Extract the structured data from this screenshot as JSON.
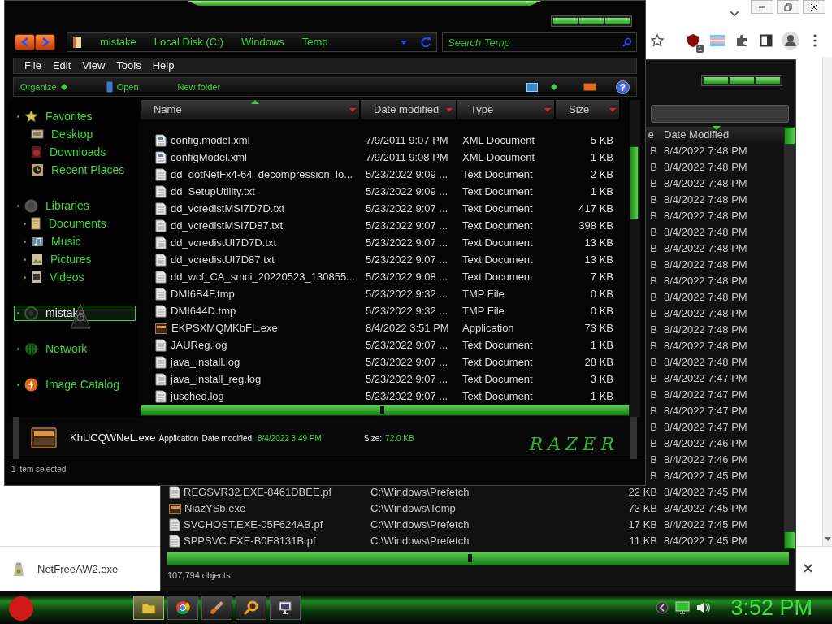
{
  "browser": {
    "extension_badge": "1"
  },
  "download_bar": {
    "file": "NetFreeAW2.exe",
    "close": "✕"
  },
  "back_window": {
    "columns": [
      {
        "label": "e"
      },
      {
        "label": "Date Modified",
        "sorted": true
      }
    ],
    "rows": [
      {
        "size": "B",
        "date": "8/4/2022 7:48 PM"
      },
      {
        "size": "B",
        "date": "8/4/2022 7:48 PM"
      },
      {
        "size": "B",
        "date": "8/4/2022 7:48 PM"
      },
      {
        "size": "B",
        "date": "8/4/2022 7:48 PM"
      },
      {
        "size": "B",
        "date": "8/4/2022 7:48 PM"
      },
      {
        "size": "B",
        "date": "8/4/2022 7:48 PM"
      },
      {
        "size": "B",
        "date": "8/4/2022 7:48 PM"
      },
      {
        "size": "B",
        "date": "8/4/2022 7:48 PM"
      },
      {
        "size": "B",
        "date": "8/4/2022 7:48 PM"
      },
      {
        "size": "B",
        "date": "8/4/2022 7:48 PM"
      },
      {
        "size": "B",
        "date": "8/4/2022 7:48 PM"
      },
      {
        "size": "B",
        "date": "8/4/2022 7:48 PM"
      },
      {
        "size": "B",
        "date": "8/4/2022 7:48 PM"
      },
      {
        "size": "B",
        "date": "8/4/2022 7:48 PM"
      },
      {
        "size": "B",
        "date": "8/4/2022 7:47 PM"
      },
      {
        "size": "B",
        "date": "8/4/2022 7:47 PM"
      },
      {
        "size": "B",
        "date": "8/4/2022 7:47 PM"
      },
      {
        "size": "B",
        "date": "8/4/2022 7:47 PM"
      },
      {
        "size": "B",
        "date": "8/4/2022 7:46 PM"
      },
      {
        "size": "B",
        "date": "8/4/2022 7:46 PM"
      },
      {
        "size": "B",
        "date": "8/4/2022 7:45 PM"
      },
      {
        "kind": "doc",
        "name": "REGSVR32.EXE-8461DBEE.pf",
        "folder": "C:\\Windows\\Prefetch",
        "size": "22 KB",
        "date": "8/4/2022 7:45 PM"
      },
      {
        "kind": "exe",
        "name": "NiazYSb.exe",
        "folder": "C:\\Windows\\Temp",
        "size": "73 KB",
        "date": "8/4/2022 7:45 PM"
      },
      {
        "kind": "doc",
        "name": "SVCHOST.EXE-05F624AB.pf",
        "folder": "C:\\Windows\\Prefetch",
        "size": "17 KB",
        "date": "8/4/2022 7:45 PM"
      },
      {
        "kind": "doc",
        "name": "SPPSVC.EXE-B0F8131B.pf",
        "folder": "C:\\Windows\\Prefetch",
        "size": "11 KB",
        "date": "8/4/2022 7:45 PM"
      }
    ],
    "status": "107,794 objects"
  },
  "window": {
    "breadcrumbs": [
      "mistake",
      "Local Disk (C:)",
      "Windows",
      "Temp"
    ],
    "search": {
      "placeholder": "Search Temp"
    },
    "menu": [
      "File",
      "Edit",
      "View",
      "Tools",
      "Help"
    ],
    "commands": [
      {
        "label": "Organize",
        "kind": "menu"
      },
      {
        "label": "Open",
        "kind": "open"
      },
      {
        "label": "New folder",
        "kind": "plain"
      }
    ],
    "help": "?",
    "sidebar": [
      {
        "label": "Favorites",
        "kind": "star",
        "expander": true,
        "selected": false,
        "children": [
          {
            "label": "Desktop",
            "kind": "desktop",
            "expander": false,
            "selected": false
          },
          {
            "label": "Downloads",
            "kind": "downloads",
            "expander": false,
            "selected": false
          },
          {
            "label": "Recent Places",
            "kind": "recent",
            "expander": false,
            "selected": false
          }
        ]
      },
      {
        "label": "Libraries",
        "kind": "libraries",
        "expander": true,
        "selected": false,
        "children": [
          {
            "label": "Documents",
            "kind": "documents",
            "expander": true,
            "selected": false
          },
          {
            "label": "Music",
            "kind": "music",
            "expander": true,
            "selected": false
          },
          {
            "label": "Pictures",
            "kind": "pictures",
            "expander": true,
            "selected": false
          },
          {
            "label": "Videos",
            "kind": "videos",
            "expander": true,
            "selected": false
          }
        ]
      },
      {
        "label": "mistake",
        "kind": "computer",
        "expander": true,
        "selected": true
      },
      {
        "label": "Network",
        "kind": "network",
        "expander": true,
        "selected": false
      },
      {
        "label": "Image Catalog",
        "kind": "catalog",
        "expander": true,
        "selected": false
      }
    ],
    "columns": [
      {
        "label": "Name",
        "sorted": true
      },
      {
        "label": "Date modified",
        "sorted": false
      },
      {
        "label": "Type",
        "sorted": false
      },
      {
        "label": "Size",
        "sorted": false
      }
    ],
    "files": [
      {
        "kind": "xml",
        "name": "config.model.xml",
        "date": "7/9/2011 9:07 PM",
        "type": "XML Document",
        "size": "5 KB"
      },
      {
        "kind": "xml",
        "name": "configModel.xml",
        "date": "7/9/2011 9:08 PM",
        "type": "XML Document",
        "size": "1 KB"
      },
      {
        "kind": "doc",
        "name": "dd_dotNetFx4-64_decompression_lo...",
        "date": "5/23/2022 9:09 ...",
        "type": "Text Document",
        "size": "2 KB"
      },
      {
        "kind": "doc",
        "name": "dd_SetupUtility.txt",
        "date": "5/23/2022 9:09 ...",
        "type": "Text Document",
        "size": "1 KB"
      },
      {
        "kind": "doc",
        "name": "dd_vcredistMSI7D7D.txt",
        "date": "5/23/2022 9:07 ...",
        "type": "Text Document",
        "size": "417 KB"
      },
      {
        "kind": "doc",
        "name": "dd_vcredistMSI7D87.txt",
        "date": "5/23/2022 9:07 ...",
        "type": "Text Document",
        "size": "398 KB"
      },
      {
        "kind": "doc",
        "name": "dd_vcredistUI7D7D.txt",
        "date": "5/23/2022 9:07 ...",
        "type": "Text Document",
        "size": "13 KB"
      },
      {
        "kind": "doc",
        "name": "dd_vcredistUI7D87.txt",
        "date": "5/23/2022 9:07 ...",
        "type": "Text Document",
        "size": "13 KB"
      },
      {
        "kind": "doc",
        "name": "dd_wcf_CA_smci_20220523_130855...",
        "date": "5/23/2022 9:08 ...",
        "type": "Text Document",
        "size": "7 KB"
      },
      {
        "kind": "doc",
        "name": "DMI6B4F.tmp",
        "date": "5/23/2022 9:32 ...",
        "type": "TMP File",
        "size": "0 KB"
      },
      {
        "kind": "doc",
        "name": "DMI644D.tmp",
        "date": "5/23/2022 9:32 ...",
        "type": "TMP File",
        "size": "0 KB"
      },
      {
        "kind": "exe",
        "name": "EKPSXMQMKbFL.exe",
        "date": "8/4/2022 3:51 PM",
        "type": "Application",
        "size": "73 KB"
      },
      {
        "kind": "doc",
        "name": "JAUReg.log",
        "date": "5/23/2022 9:07 ...",
        "type": "Text Document",
        "size": "1 KB"
      },
      {
        "kind": "doc",
        "name": "java_install.log",
        "date": "5/23/2022 9:07 ...",
        "type": "Text Document",
        "size": "28 KB"
      },
      {
        "kind": "doc",
        "name": "java_install_reg.log",
        "date": "5/23/2022 9:07 ...",
        "type": "Text Document",
        "size": "3 KB"
      },
      {
        "kind": "doc",
        "name": "jusched.log",
        "date": "5/23/2022 9:07 ...",
        "type": "Text Document",
        "size": "1 KB"
      }
    ],
    "details": {
      "name": "KhUCQWNeL.exe",
      "type": "Application",
      "date_label": "Date modified:",
      "date": "8/4/2022 3:49 PM",
      "size_label": "Size:",
      "size": "72.0 KB",
      "logo": "RAZER"
    },
    "status": "1 item selected"
  },
  "taskbar": {
    "apps": [
      {
        "kind": "folder",
        "selected": true
      },
      {
        "kind": "browser",
        "selected": false
      },
      {
        "kind": "brush",
        "selected": false
      },
      {
        "kind": "search",
        "selected": false
      },
      {
        "kind": "monitor",
        "selected": false
      }
    ],
    "clock": "3:52 PM"
  }
}
